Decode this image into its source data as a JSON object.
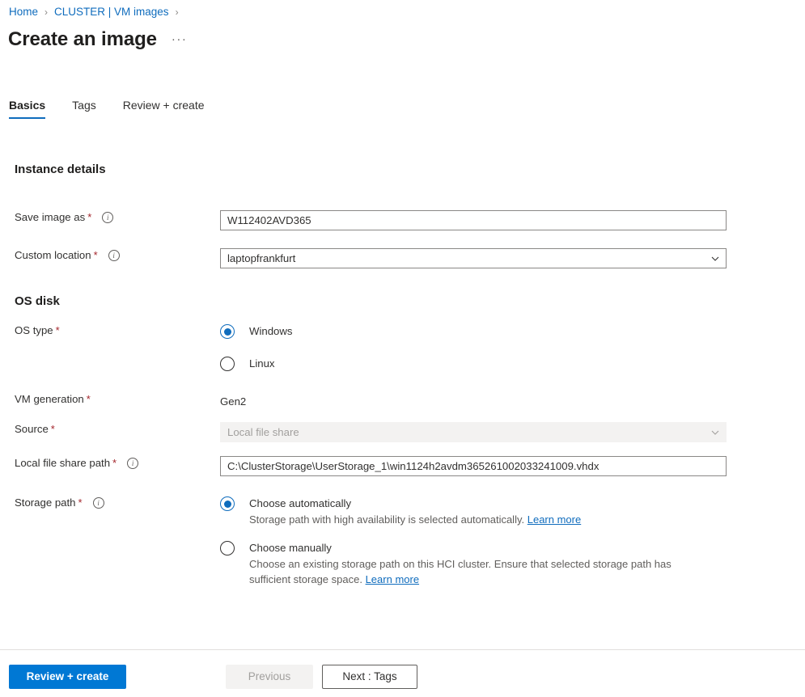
{
  "breadcrumb": {
    "items": [
      {
        "label": "Home"
      },
      {
        "label": "CLUSTER | VM images"
      }
    ],
    "separator": "›"
  },
  "header": {
    "title": "Create an image",
    "more_menu": "···"
  },
  "tabs": [
    {
      "label": "Basics",
      "active": true
    },
    {
      "label": "Tags",
      "active": false
    },
    {
      "label": "Review + create",
      "active": false
    }
  ],
  "sections": {
    "instance_details": {
      "heading": "Instance details",
      "save_image_as": {
        "label": "Save image as",
        "required": "*",
        "info": "ⓘ",
        "value": "W112402AVD365",
        "placeholder": ""
      },
      "custom_location": {
        "label": "Custom location",
        "required": "*",
        "info": "ⓘ",
        "value": "laptopfrankfurt"
      }
    },
    "os_disk": {
      "heading": "OS disk",
      "os_type": {
        "label": "OS type",
        "required": "*",
        "options": [
          {
            "label": "Windows",
            "selected": true
          },
          {
            "label": "Linux",
            "selected": false
          }
        ]
      },
      "vm_generation": {
        "label": "VM generation",
        "required": "*",
        "value": "Gen2"
      },
      "source": {
        "label": "Source",
        "required": "*",
        "value": "Local file share",
        "disabled": true
      },
      "local_file_share_path": {
        "label": "Local file share path",
        "required": "*",
        "value": "C:\\ClusterStorage\\UserStorage_1\\win1124h2avdm365261002033241009.vhdx"
      },
      "storage_path": {
        "label": "Storage path",
        "required": "*",
        "options": [
          {
            "label": "Choose automatically",
            "selected": true,
            "description": "Storage path with high availability is selected automatically.",
            "link": "Learn more"
          },
          {
            "label": "Choose manually",
            "selected": false,
            "description": "Choose an existing storage path on this HCI cluster. Ensure that selected storage path has sufficient storage space.",
            "link": "Learn more"
          }
        ]
      }
    }
  },
  "footer": {
    "review_create": "Review + create",
    "previous": "Previous",
    "next": "Next : Tags"
  },
  "colors": {
    "accent": "#0078d4",
    "link": "#0f6cbd",
    "required": "#a4262c",
    "disabled_bg": "#f3f2f1"
  }
}
